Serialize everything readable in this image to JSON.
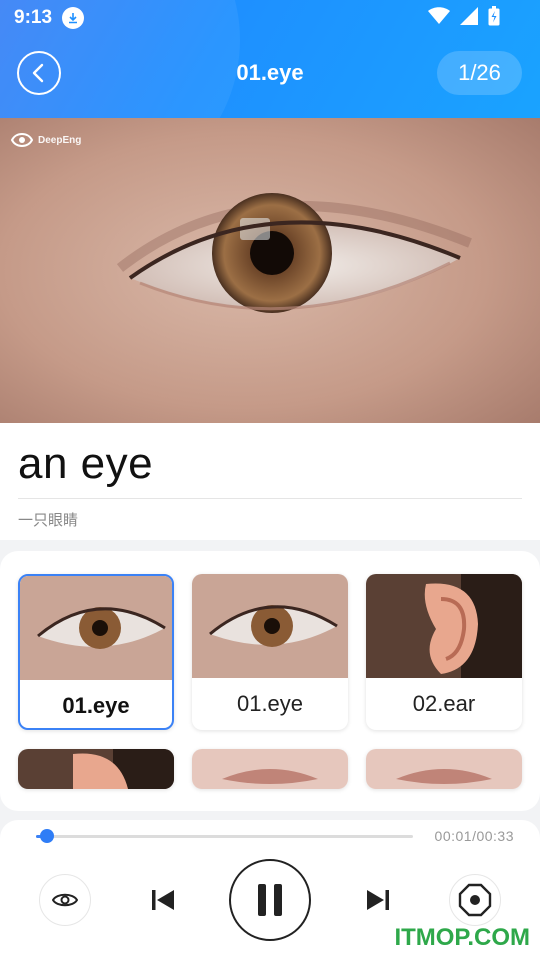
{
  "status_bar": {
    "time": "9:13"
  },
  "header": {
    "title": "01.eye",
    "counter": "1/26"
  },
  "hero": {
    "watermark": "DeepEng"
  },
  "word": {
    "text": "an eye",
    "translation": "一只眼睛"
  },
  "thumbnails": [
    {
      "label": "01.eye",
      "selected": true
    },
    {
      "label": "01.eye",
      "selected": false
    },
    {
      "label": "02.ear",
      "selected": false
    }
  ],
  "player": {
    "time": "00:01/00:33",
    "progress": 0.03
  },
  "footer": {
    "site_mark": "ITMOP.COM"
  },
  "colors": {
    "accent": "#2f7df6",
    "header_start": "#3b82f6",
    "header_end": "#1aa3ff"
  }
}
